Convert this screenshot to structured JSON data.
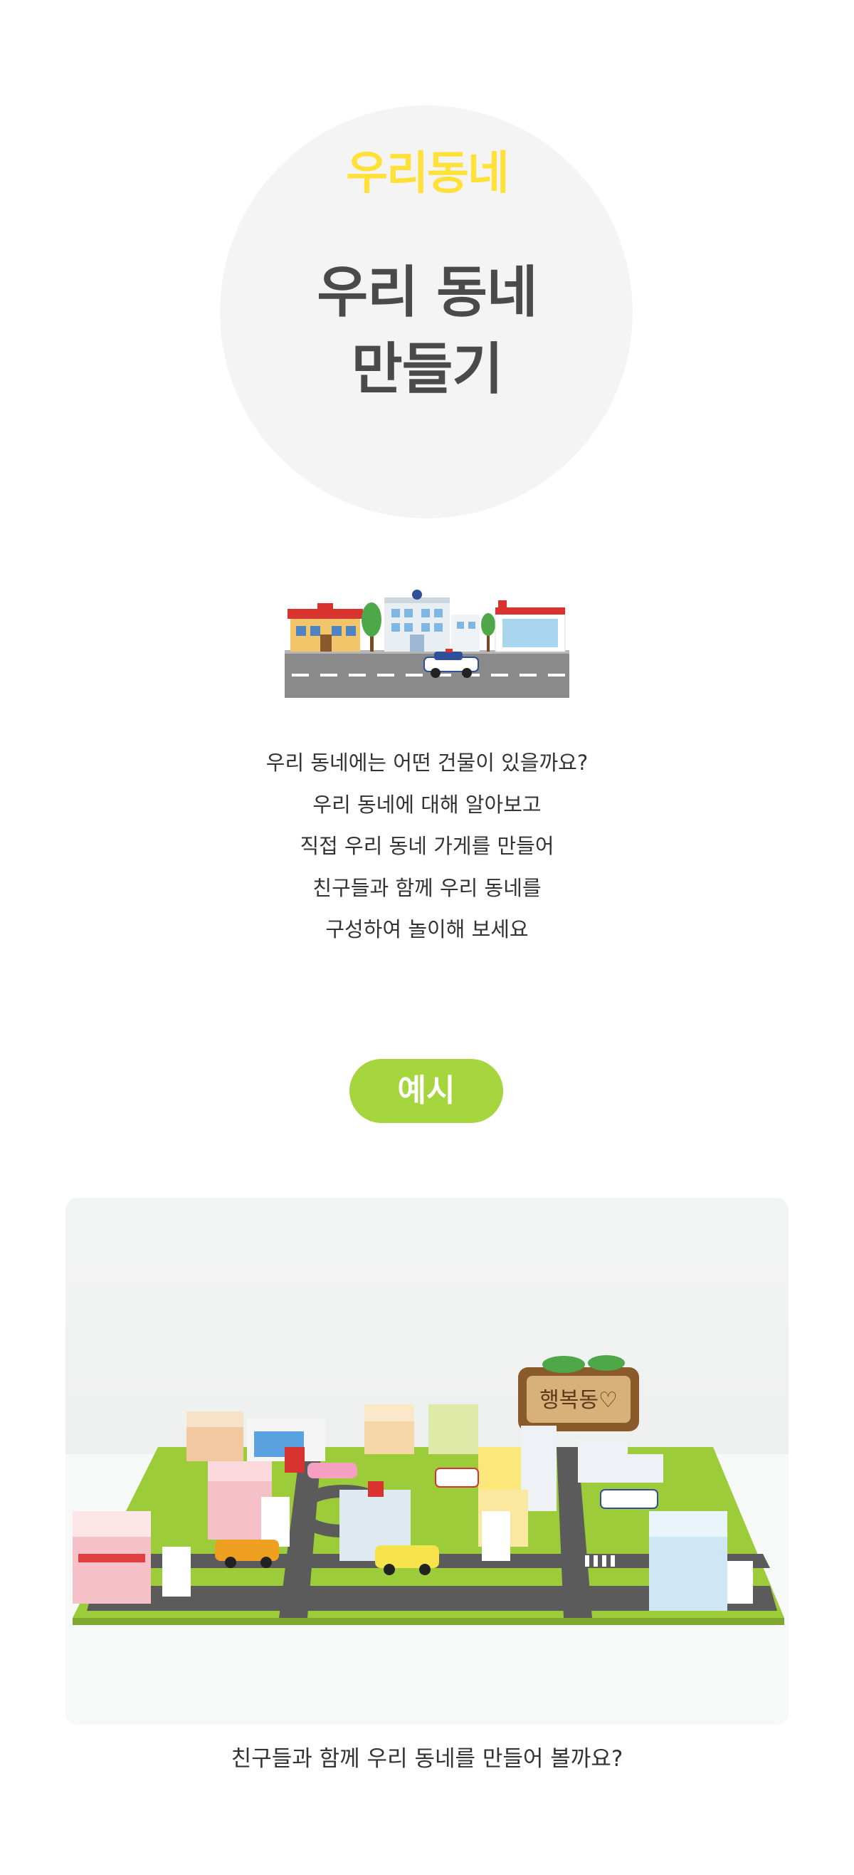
{
  "hero": {
    "kicker": "우리동네",
    "title_line1": "우리 동네",
    "title_line2": "만들기"
  },
  "intro": {
    "lines": [
      "우리 동네에는 어떤 건물이 있을까요?",
      "우리 동네에 대해 알아보고",
      "직접 우리 동네 가게를 만들어",
      "친구들과 함께 우리 동네를",
      "구성하여 놀이해 보세요"
    ]
  },
  "example": {
    "label": "예시"
  },
  "photo": {
    "sign_text": "행복동♡"
  },
  "caption": "친구들과 함께 우리 동네를 만들어 볼까요?",
  "colors": {
    "kicker": "#ffe13a",
    "title": "#4a4a4a",
    "pill": "#a6d63d",
    "circle": "#f4f4f4",
    "text": "#333333"
  }
}
